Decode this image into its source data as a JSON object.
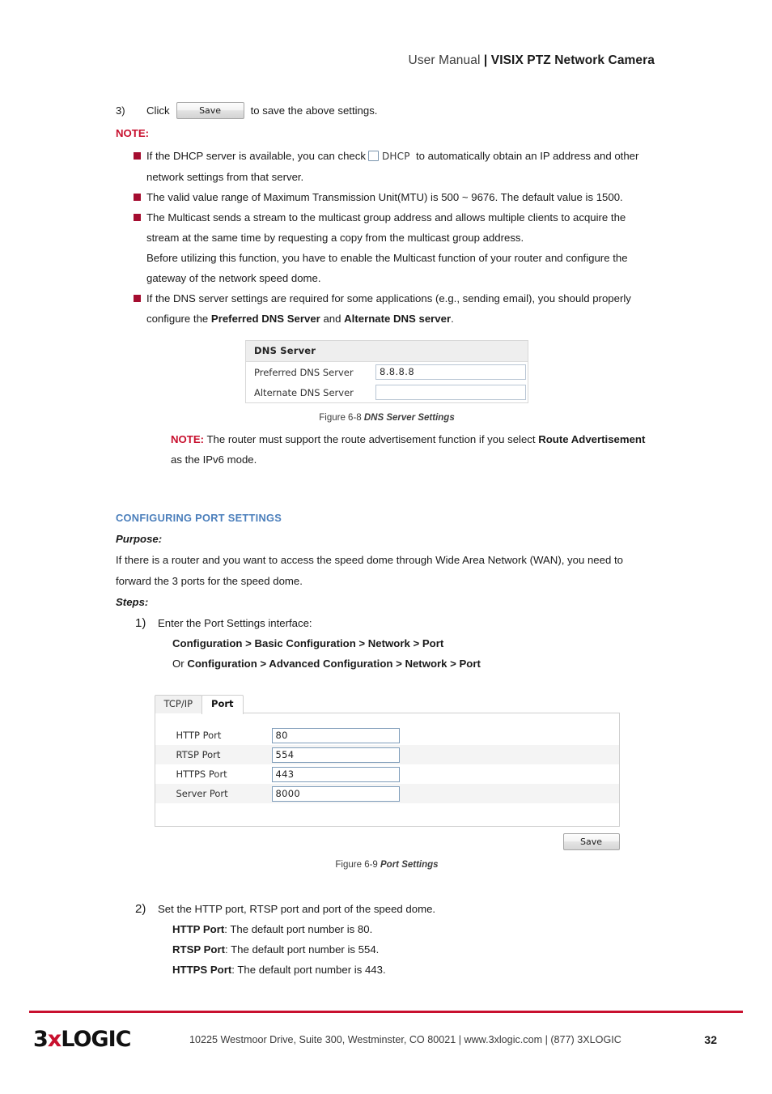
{
  "header": {
    "light": "User Manual ",
    "bold": "| VISIX PTZ Network Camera"
  },
  "step3": {
    "number": "3)",
    "before": "Click",
    "save_label": "Save",
    "after": "to save the above settings."
  },
  "note_label": "NOTE:",
  "bullets": {
    "dhcp_part1": "If the DHCP server is available, you can check",
    "dhcp_checkbox_label": "DHCP",
    "dhcp_part2": "to automatically obtain an IP address and other network settings from that server.",
    "mtu": "The valid value range of Maximum Transmission Unit(MTU) is 500 ~ 9676. The default value is 1500.",
    "multicast": "The Multicast sends a stream to the multicast group address and allows multiple clients to acquire the stream at the same time by requesting a copy from the multicast group address.",
    "multicast_extra": "Before utilizing this function, you have to enable the Multicast function of your router and configure the gateway of the network speed dome.",
    "dns_lead": "If the DNS server settings are required for some applications (e.g., sending email), you should properly configure the ",
    "dns_bold1": "Preferred DNS Server",
    "dns_mid": " and ",
    "dns_bold2": "Alternate DNS server",
    "dns_end": "."
  },
  "dns_figure": {
    "title": "DNS Server",
    "rows": [
      {
        "label": "Preferred DNS Server",
        "value": "8.8.8.8"
      },
      {
        "label": "Alternate DNS Server",
        "value": ""
      }
    ],
    "caption_num": "Figure 6-8 ",
    "caption_name": "DNS Server Settings"
  },
  "route_note": {
    "label": "NOTE:",
    "text1": " The router must support the route advertisement function if you select ",
    "bold": "Route Advertisement",
    "text2": " as the IPv6 mode."
  },
  "port_section": {
    "heading": "CONFIGURING PORT SETTINGS",
    "purpose_label": "Purpose:",
    "purpose_text": "If there is a router and you want to access the speed dome through Wide Area Network (WAN), you need to forward the 3 ports for the speed dome.",
    "steps_label": "Steps:",
    "step1_num": "1)",
    "step1_text": "Enter the Port Settings interface:",
    "step1_path1": "Configuration > Basic Configuration > Network > Port",
    "step1_path2_prefix": "Or ",
    "step1_path2": "Configuration > Advanced Configuration > Network > Port",
    "step2_num": "2)",
    "step2_text": "Set the HTTP port, RTSP port and port of the speed dome.",
    "step2_lines": [
      {
        "bold": "HTTP Port",
        "rest": ": The default port number is 80."
      },
      {
        "bold": "RTSP Port",
        "rest": ": The default port number is 554."
      },
      {
        "bold": "HTTPS Port",
        "rest": ": The default port number is 443."
      }
    ]
  },
  "port_figure": {
    "tabs": [
      {
        "label": "TCP/IP",
        "active": false
      },
      {
        "label": "Port",
        "active": true
      }
    ],
    "rows": [
      {
        "label": "HTTP Port",
        "value": "80"
      },
      {
        "label": "RTSP Port",
        "value": "554"
      },
      {
        "label": "HTTPS Port",
        "value": "443"
      },
      {
        "label": "Server Port",
        "value": "8000"
      }
    ],
    "save_label": "Save",
    "caption_num": "Figure 6-9 ",
    "caption_name": "Port Settings"
  },
  "footer": {
    "logo_pre": "3",
    "logo_x": "x",
    "logo_post": "LOGIC",
    "address": "10225 Westmoor Drive, Suite 300, Westminster, CO 80021 | www.3xlogic.com | (877) 3XLOGIC",
    "page_number": "32"
  },
  "colors": {
    "brand_red": "#c8102e",
    "bullet_red": "#a50d30",
    "heading_blue": "#4a7ebb"
  }
}
